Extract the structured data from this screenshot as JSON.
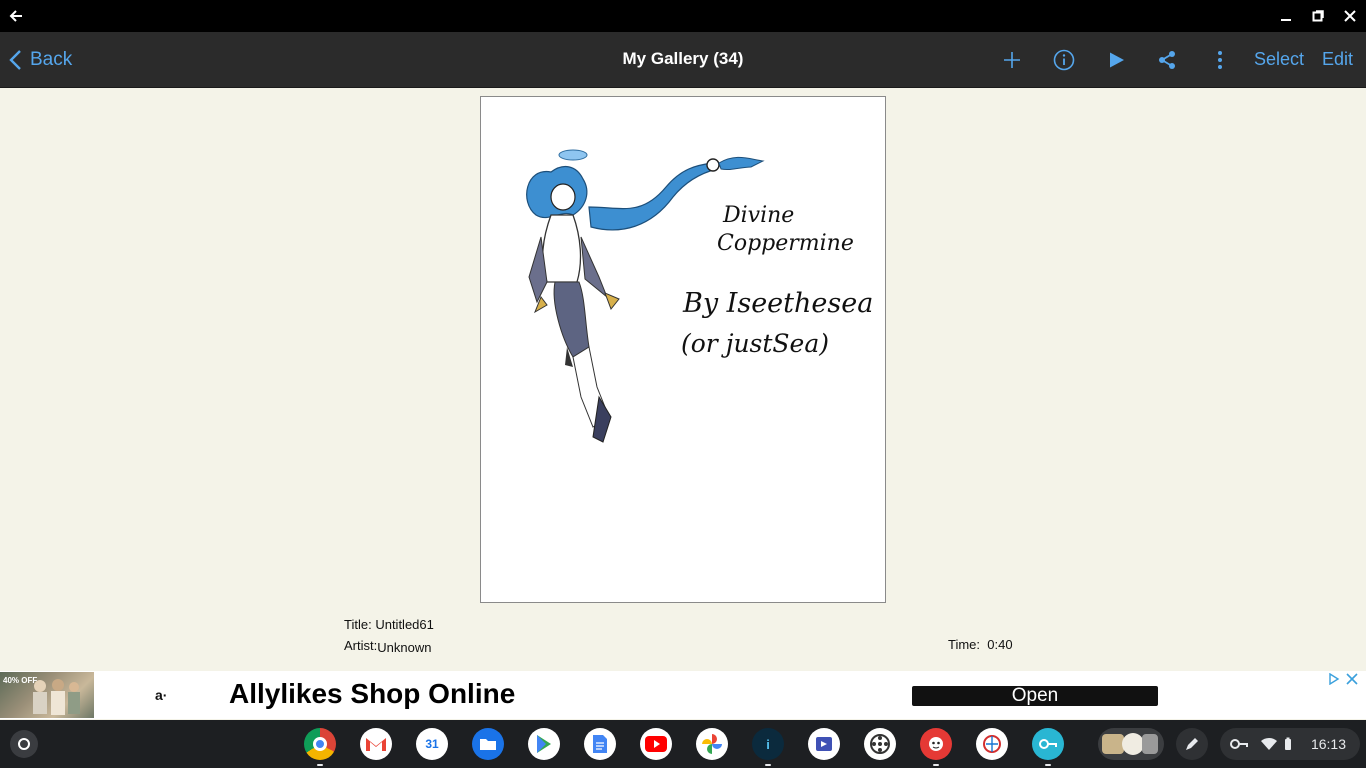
{
  "window": {
    "back_icon": "arrow-left-icon",
    "controls": [
      "minimize-icon",
      "restore-icon",
      "close-icon"
    ]
  },
  "toolbar": {
    "back_label": "Back",
    "title": "My Gallery (34)",
    "actions": [
      "add-icon",
      "info-icon",
      "play-icon",
      "share-icon",
      "more-vertical-icon"
    ],
    "select_label": "Select",
    "edit_label": "Edit",
    "accent_color": "#55a6ec"
  },
  "artwork": {
    "handwriting_line1": "Divine",
    "handwriting_line2": "Coppermine",
    "handwriting_line3": "By Iseethesea",
    "handwriting_line4": "(or justSea)"
  },
  "info": {
    "title_label": "Title:",
    "title_value": "Untitled61",
    "artist_label": "Artist:",
    "artist_value": "Unknown",
    "time_label": "Time:",
    "time_value": "0:40"
  },
  "ad": {
    "thumb_badge": "40% OFF",
    "logo": "a·",
    "headline": "Allylikes Shop Online",
    "cta": "Open",
    "icons": [
      "adchoices-icon",
      "close-icon"
    ]
  },
  "shelf": {
    "apps": [
      "chrome",
      "gmail",
      "calendar",
      "files",
      "play-store",
      "docs",
      "youtube",
      "photos",
      "ibis-paint",
      "media-app",
      "app-icon-a",
      "app-icon-b",
      "app-icon-c",
      "app-icon-d"
    ],
    "calendar_day": "31",
    "clock": "16:13",
    "status_icons": [
      "vpn-key-icon",
      "wifi-icon",
      "battery-icon"
    ]
  }
}
